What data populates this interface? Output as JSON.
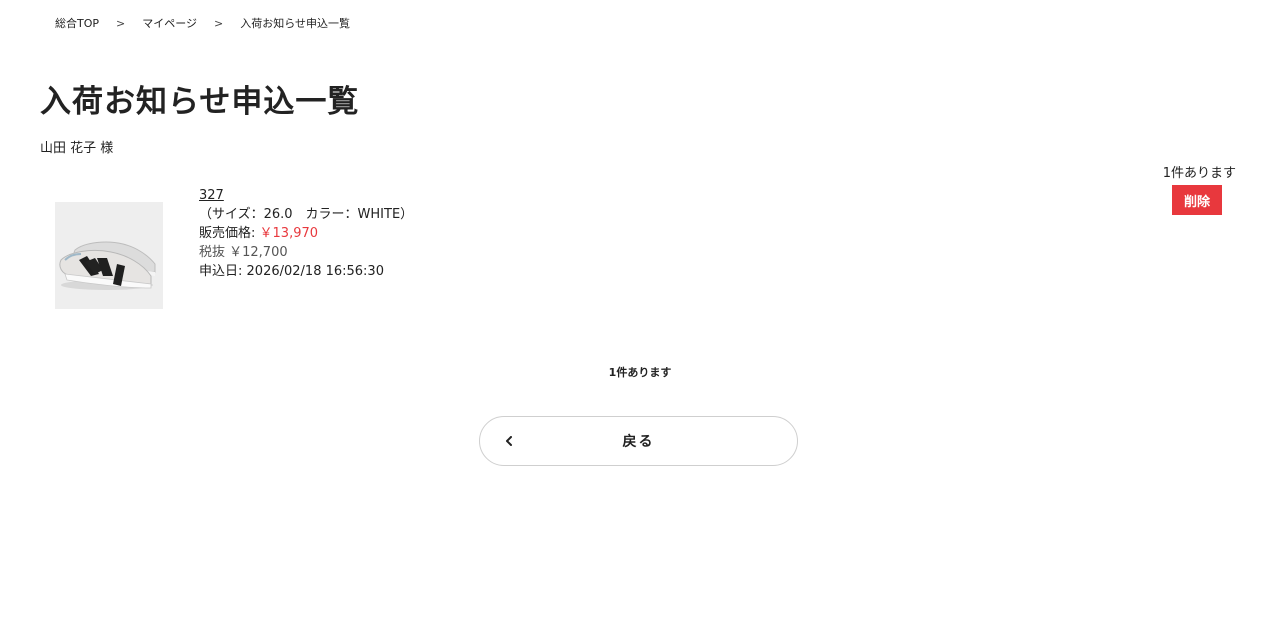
{
  "breadcrumb": {
    "items": [
      "総合TOP",
      "マイページ",
      "入荷お知らせ申込一覧"
    ],
    "separator": ">"
  },
  "page": {
    "title": "入荷お知らせ申込一覧",
    "user_name": "山田 花子 様",
    "count_top": "1件あります",
    "count_bottom": "1件あります"
  },
  "actions": {
    "delete_label": "削除",
    "back_label": "戻る"
  },
  "product": {
    "name": "327",
    "variant": "（サイズ：26.0　カラー：WHITE）",
    "price_label": "販売価格:",
    "price_value": "￥13,970",
    "tax_excluded": "税抜 ￥12,700",
    "applied_label": "申込日:",
    "applied_value": "2026/02/18 16:56:30",
    "image": "sneaker-image"
  },
  "colors": {
    "accent_red": "#e8383d",
    "text": "#222222",
    "button_border": "#cfcfcf",
    "thumb_bg": "#eeeeee"
  },
  "icons": {
    "back": "chevron-left-icon"
  }
}
